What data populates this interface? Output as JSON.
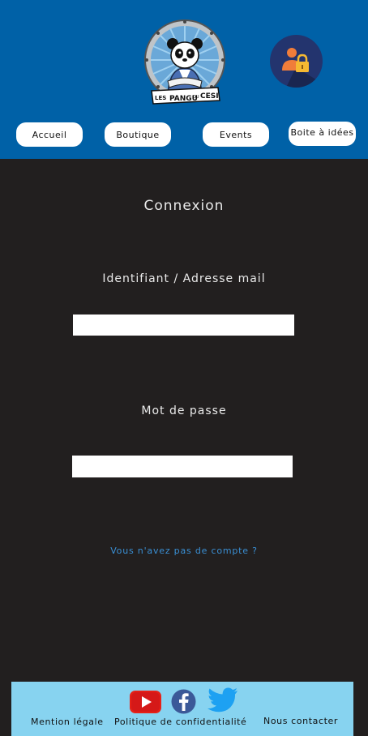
{
  "header": {
    "logo_text_top": "LES",
    "logo_text_main": "PANGU",
    "logo_text_dv": "DU",
    "logo_text_end": "CESI",
    "colors": {
      "background": "#0061a7",
      "account_bg": "#23346e",
      "lock": "#f5b932",
      "user": "#f07d3a"
    }
  },
  "nav": {
    "items": [
      {
        "label": "Accueil"
      },
      {
        "label": "Boutique"
      },
      {
        "label": "Events"
      },
      {
        "label": "Boite à idées"
      }
    ]
  },
  "login": {
    "title": "Connexion",
    "username_label": "Identifiant / Adresse mail",
    "username_value": "",
    "password_label": "Mot de passe",
    "password_value": "",
    "signup_link": "Vous n'avez pas de compte ?"
  },
  "footer": {
    "legal": "Mention légale",
    "privacy": "Politique de confidentialité",
    "contact": "Nous contacter",
    "social": [
      "youtube-icon",
      "facebook-icon",
      "twitter-icon"
    ],
    "colors": {
      "background": "#87d3f0"
    }
  }
}
